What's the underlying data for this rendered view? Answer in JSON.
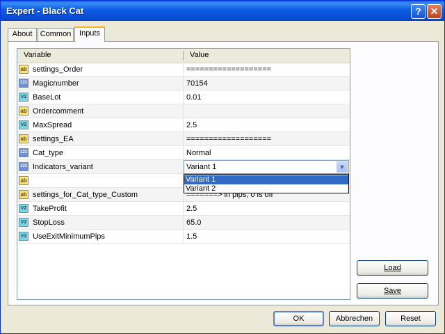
{
  "window": {
    "title": "Expert - Black Cat"
  },
  "titlebar_buttons": {
    "help": "?",
    "close": "✕"
  },
  "tabs": [
    {
      "label": "About"
    },
    {
      "label": "Common"
    },
    {
      "label": "Inputs",
      "active": true
    }
  ],
  "grid": {
    "headers": {
      "variable": "Variable",
      "value": "Value"
    },
    "rows": [
      {
        "icon": "ab",
        "variable": "settings_Order",
        "value": "==================="
      },
      {
        "icon": "123",
        "variable": "Magicnumber",
        "value": "70154"
      },
      {
        "icon": "V2",
        "variable": "BaseLot",
        "value": "0.01"
      },
      {
        "icon": "ab",
        "variable": "Ordercomment",
        "value": ""
      },
      {
        "icon": "V2",
        "variable": "MaxSpread",
        "value": "2.5"
      },
      {
        "icon": "ab",
        "variable": "settings_EA",
        "value": "==================="
      },
      {
        "icon": "123",
        "variable": "Cat_type",
        "value": "Normal"
      },
      {
        "icon": "123",
        "variable": "Indicators_variant",
        "value": "Variant 1"
      },
      {
        "icon": "ab",
        "variable": "",
        "value": ""
      },
      {
        "icon": "ab",
        "variable": "settings_for_Cat_type_Custom",
        "value": "=======> in pips, 0 is off"
      },
      {
        "icon": "V2",
        "variable": "TakeProfit",
        "value": "2.5"
      },
      {
        "icon": "V2",
        "variable": "StopLoss",
        "value": "65.0"
      },
      {
        "icon": "V2",
        "variable": "UseExitMinimumPips",
        "value": "1.5"
      }
    ]
  },
  "dropdown": {
    "selected": "Variant 1",
    "arrow": "▼",
    "options": [
      "Variant 1",
      "Variant 2"
    ]
  },
  "side_buttons": {
    "load": "Load",
    "save": "Save"
  },
  "footer_buttons": {
    "ok": "OK",
    "cancel": "Abbrechen",
    "reset": "Reset"
  }
}
